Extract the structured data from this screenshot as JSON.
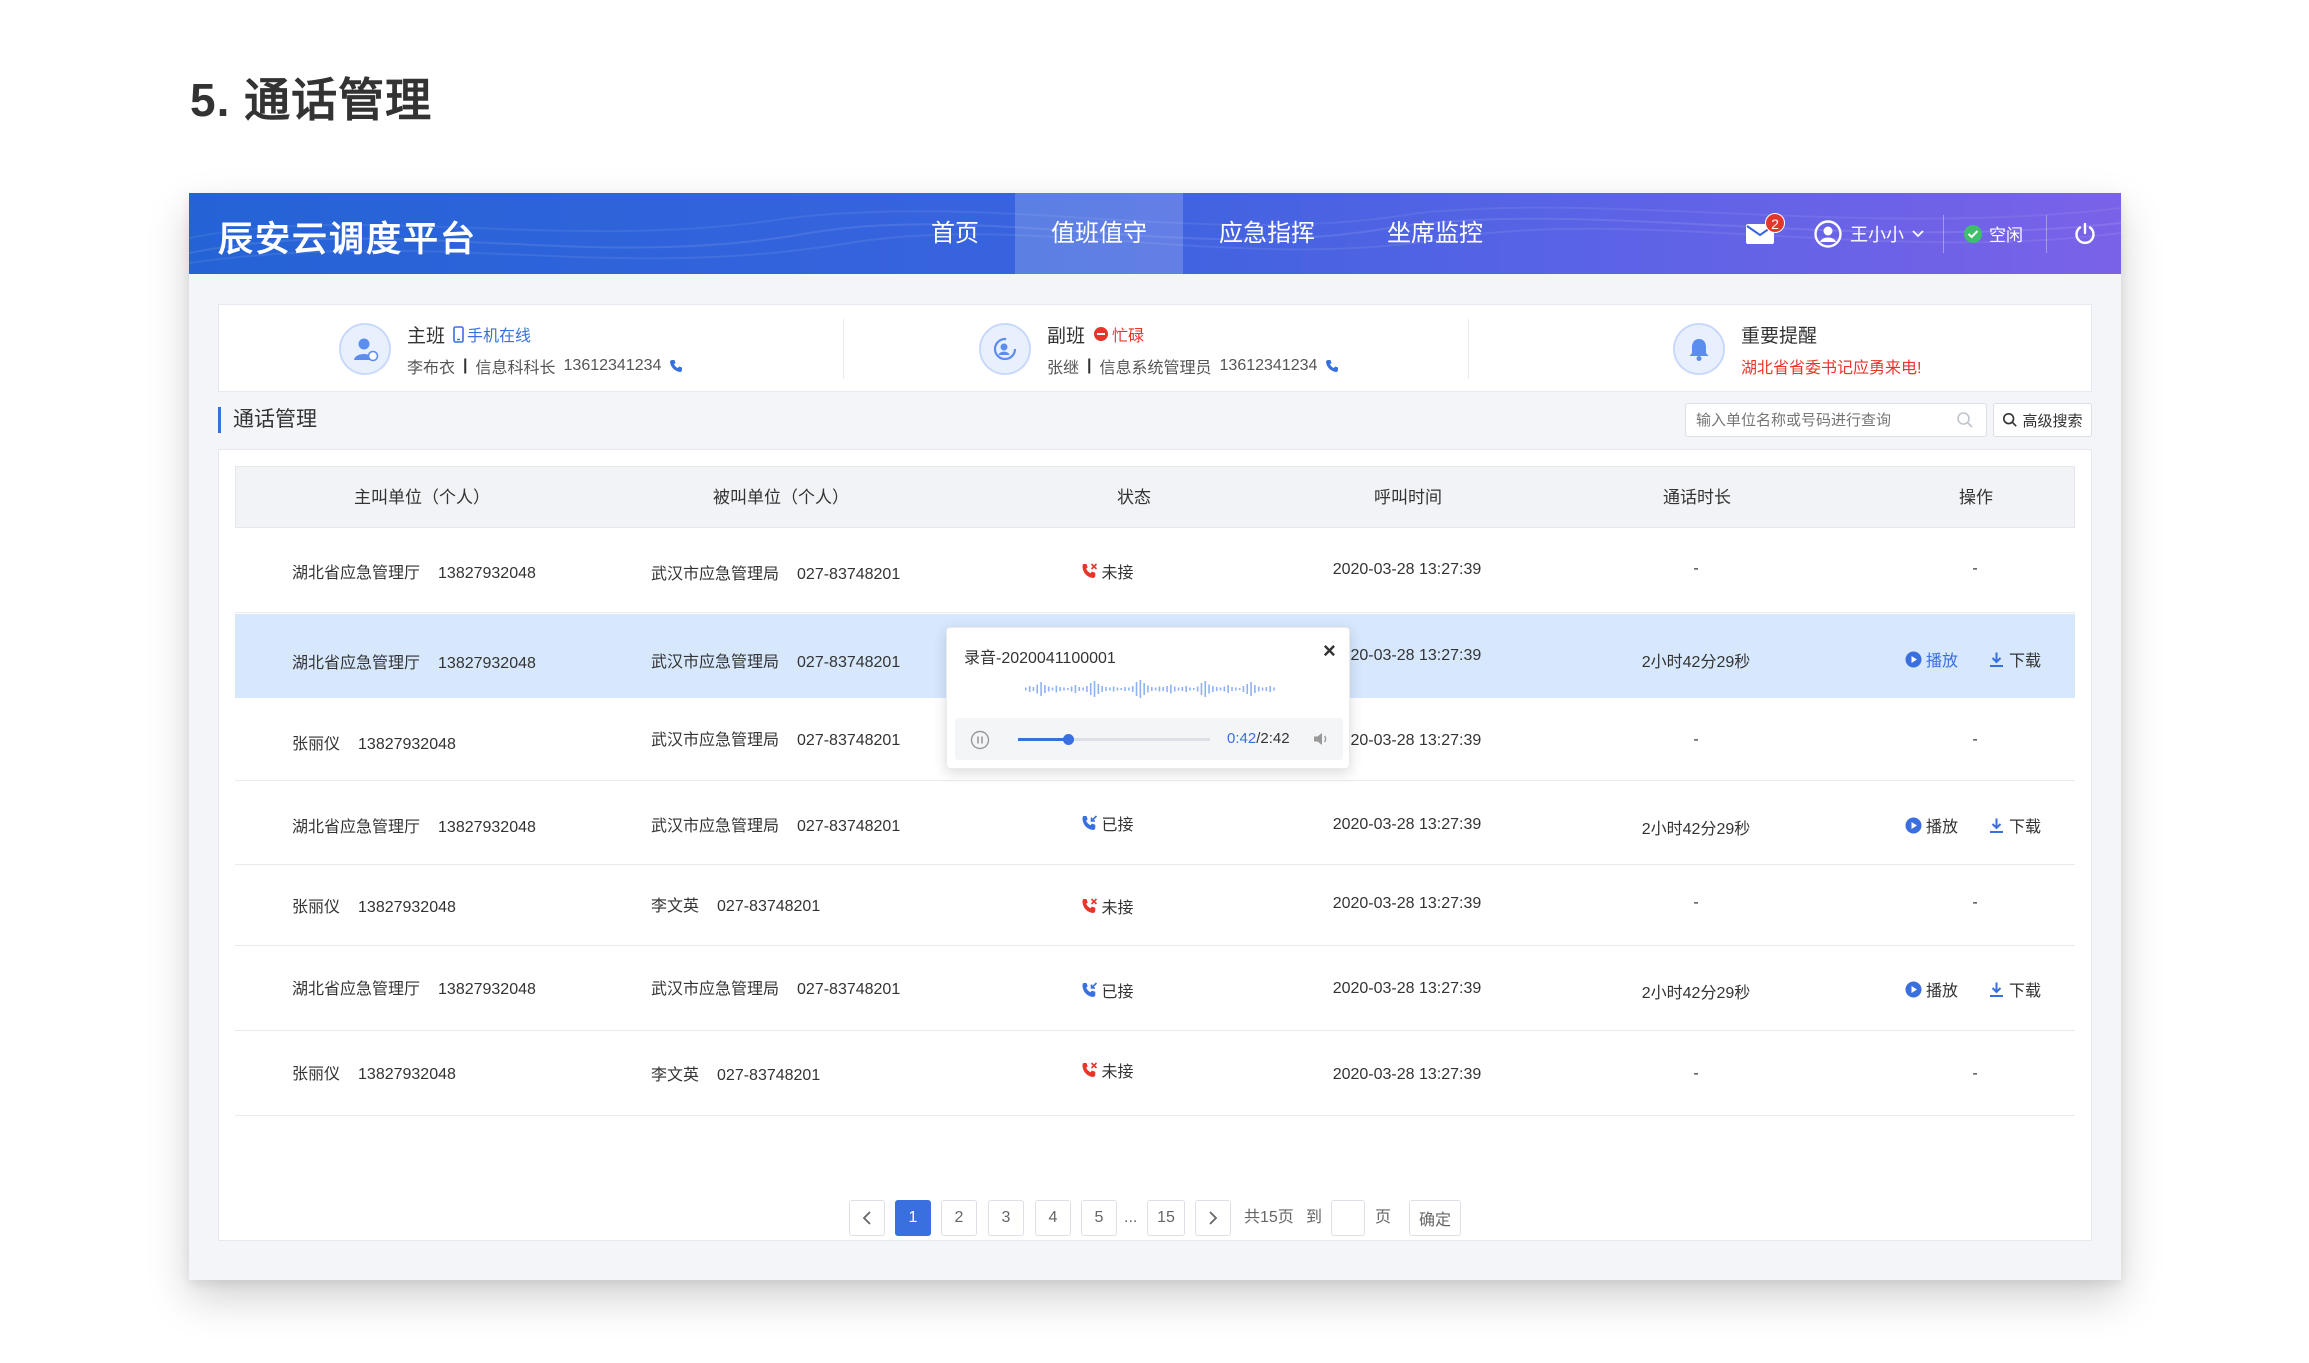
{
  "page_heading": "5. 通话管理",
  "app": {
    "brand": "辰安云调度平台",
    "nav": [
      "首页",
      "值班值守",
      "应急指挥",
      "坐席监控"
    ],
    "active_nav": 1,
    "mail_badge": "2",
    "user_name": "王小小",
    "status_label": "空闲"
  },
  "duty": {
    "main": {
      "role": "主班",
      "tag": "手机在线",
      "name": "李布衣",
      "title": "信息科科长",
      "phone": "13612341234"
    },
    "deputy": {
      "role": "副班",
      "tag": "忙碌",
      "name": "张继",
      "title": "信息系统管理员",
      "phone": "13612341234"
    },
    "alert": {
      "title": "重要提醒",
      "message": "湖北省省委书记应勇来电!"
    }
  },
  "section": {
    "title": "通话管理",
    "search_placeholder": "输入单位名称或号码进行查询",
    "advanced_search": "高级搜索"
  },
  "table": {
    "headers": [
      "主叫单位（个人）",
      "被叫单位（个人）",
      "状态",
      "呼叫时间",
      "通话时长",
      "操作"
    ],
    "play_label": "播放",
    "download_label": "下载",
    "rows": [
      {
        "caller": "湖北省应急管理厅",
        "caller_phone": "13827932048",
        "callee": "武汉市应急管理局",
        "callee_phone": "027-83748201",
        "status": "未接",
        "time": "2020-03-28 13:27:39",
        "duration": "-",
        "ops": "-"
      },
      {
        "caller": "湖北省应急管理厅",
        "caller_phone": "13827932048",
        "callee": "武汉市应急管理局",
        "callee_phone": "027-83748201",
        "status": "",
        "time": "2020-03-28 13:27:39",
        "duration": "2小时42分29秒",
        "ops": ""
      },
      {
        "caller": "张丽仪",
        "caller_phone": "13827932048",
        "callee": "武汉市应急管理局",
        "callee_phone": "027-83748201",
        "status": "",
        "time": "2020-03-28 13:27:39",
        "duration": "-",
        "ops": "-"
      },
      {
        "caller": "湖北省应急管理厅",
        "caller_phone": "13827932048",
        "callee": "武汉市应急管理局",
        "callee_phone": "027-83748201",
        "status": "已接",
        "time": "2020-03-28 13:27:39",
        "duration": "2小时42分29秒",
        "ops": ""
      },
      {
        "caller": "张丽仪",
        "caller_phone": "13827932048",
        "callee": "李文英",
        "callee_phone": "027-83748201",
        "status": "未接",
        "time": "2020-03-28 13:27:39",
        "duration": "-",
        "ops": "-"
      },
      {
        "caller": "湖北省应急管理厅",
        "caller_phone": "13827932048",
        "callee": "武汉市应急管理局",
        "callee_phone": "027-83748201",
        "status": "已接",
        "time": "2020-03-28 13:27:39",
        "duration": "2小时42分29秒",
        "ops": ""
      },
      {
        "caller": "张丽仪",
        "caller_phone": "13827932048",
        "callee": "李文英",
        "callee_phone": "027-83748201",
        "status": "未接",
        "time": "2020-03-28 13:27:39",
        "duration": "-",
        "ops": "-"
      }
    ]
  },
  "recording": {
    "title": "录音-2020041100001",
    "current": "0:42",
    "total": "2:42",
    "progress": 0.26
  },
  "pagination": {
    "pages": [
      "1",
      "2",
      "3",
      "4",
      "5"
    ],
    "ellipsis": "...",
    "last": "15",
    "total_text": "共15页",
    "goto": "到",
    "page_unit": "页",
    "confirm": "确定"
  },
  "colors": {
    "accent": "#3a6fe0",
    "missed": "#e8352a",
    "answered": "#3a6fe0",
    "highlight": "#d7e8fd"
  }
}
